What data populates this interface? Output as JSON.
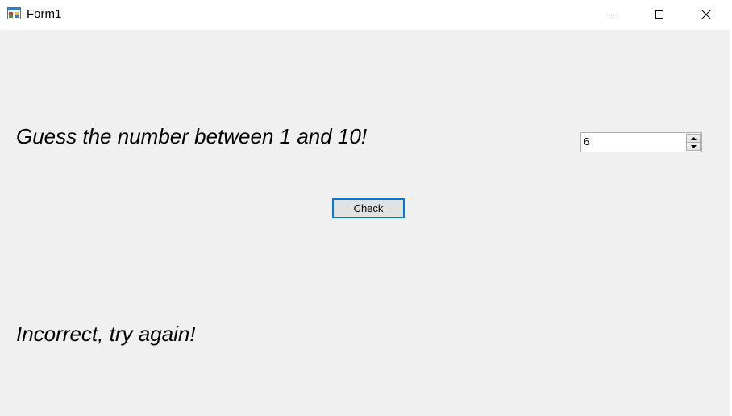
{
  "window": {
    "title": "Form1",
    "controls": {
      "minimize_icon": "minimize-icon",
      "maximize_icon": "maximize-icon",
      "close_icon": "close-icon"
    }
  },
  "form": {
    "prompt": "Guess the number between 1 and 10!",
    "guess_value": "6",
    "check_label": "Check",
    "result": "Incorrect, try again!"
  },
  "colors": {
    "background": "#f0f0f0",
    "focus_border": "#0078d7",
    "titlebar": "#ffffff"
  }
}
